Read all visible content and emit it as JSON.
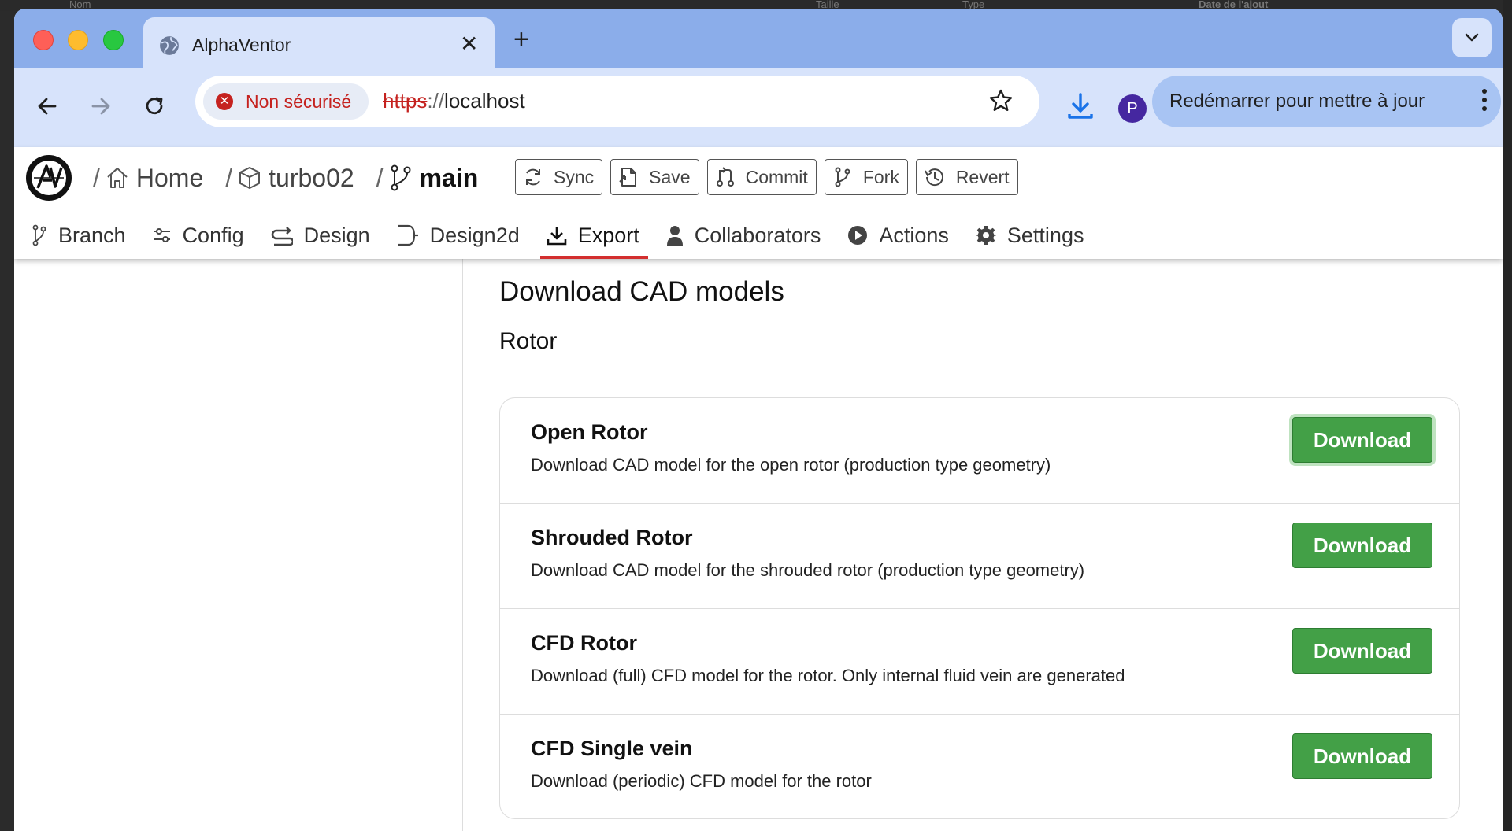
{
  "browser": {
    "tab_title": "AlphaVentor",
    "security_label": "Non sécurisé",
    "url_scheme": "https",
    "url_sep": "://",
    "url_host": "localhost",
    "profile_initial": "P",
    "update_label": "Redémarrer pour mettre à jour"
  },
  "background_labels": [
    "Nom",
    "Taille",
    "Type",
    "Date de l'ajout"
  ],
  "breadcrumb": {
    "home": "Home",
    "project": "turbo02",
    "branch": "main"
  },
  "actions": [
    "Sync",
    "Save",
    "Commit",
    "Fork",
    "Revert"
  ],
  "nav_tabs": [
    "Branch",
    "Config",
    "Design",
    "Design2d",
    "Export",
    "Collaborators",
    "Actions",
    "Settings"
  ],
  "active_tab": "Export",
  "page": {
    "title": "Download CAD models",
    "section": "Rotor"
  },
  "models": [
    {
      "title": "Open Rotor",
      "description": "Download CAD model for the open rotor (production type geometry)",
      "button": "Download"
    },
    {
      "title": "Shrouded Rotor",
      "description": "Download CAD model for the shrouded rotor (production type geometry)",
      "button": "Download"
    },
    {
      "title": "CFD Rotor",
      "description": "Download (full) CFD model for the rotor. Only internal fluid vein are generated",
      "button": "Download"
    },
    {
      "title": "CFD Single vein",
      "description": "Download (periodic) CFD model for the rotor",
      "button": "Download"
    }
  ],
  "colors": {
    "tabstrip": "#8badea",
    "toolbar": "#d7e3fb",
    "download_button": "#43a047",
    "active_tab_underline": "#d32f2f",
    "insecure": "#c5221f"
  }
}
